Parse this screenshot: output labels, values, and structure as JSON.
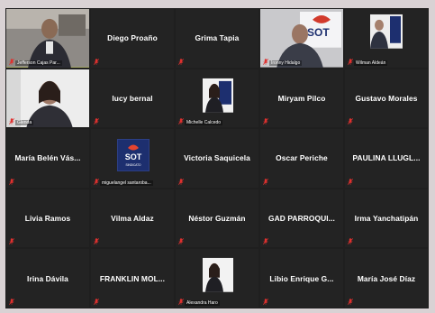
{
  "tiles": [
    {
      "id": "t1",
      "label": "Jefferson Cajas Par...",
      "kind": "video-man-office",
      "speaking": true
    },
    {
      "id": "t2",
      "name": "Diego Proaño"
    },
    {
      "id": "t3",
      "name": "Grima Tapia"
    },
    {
      "id": "t4",
      "label": "Ironny Hidalgo",
      "kind": "video-man-sot"
    },
    {
      "id": "t5",
      "label": "Wilman Aldeán",
      "kind": "video-man-small"
    },
    {
      "id": "t6",
      "label": "Glenda",
      "kind": "video-woman"
    },
    {
      "id": "t7",
      "name": "lucy bernal"
    },
    {
      "id": "t8",
      "label": "Michelle Calcedo",
      "kind": "video-woman-small"
    },
    {
      "id": "t9",
      "name": "Miryam Pilco"
    },
    {
      "id": "t10",
      "name": "Gustavo Morales"
    },
    {
      "id": "t11",
      "name": "María Belén Vás..."
    },
    {
      "id": "t12",
      "label": "miguelangel santaroba...",
      "kind": "logo-sot",
      "logo_text": "SOT",
      "logo_sub": "SINDICATO"
    },
    {
      "id": "t13",
      "name": "Victoria Saquicela"
    },
    {
      "id": "t14",
      "name": "Oscar Periche"
    },
    {
      "id": "t15",
      "name": "PAULINA LLUGL..."
    },
    {
      "id": "t16",
      "name": "Livia Ramos"
    },
    {
      "id": "t17",
      "name": "Vilma Aldaz"
    },
    {
      "id": "t18",
      "name": "Néstor Guzmán"
    },
    {
      "id": "t19",
      "name": "GAD PARROQUI..."
    },
    {
      "id": "t20",
      "name": "Irma Yanchatipán"
    },
    {
      "id": "t21",
      "name": "Irina Dávila"
    },
    {
      "id": "t22",
      "name": "FRANKLIN MOL..."
    },
    {
      "id": "t23",
      "label": "Alexandra Haro",
      "kind": "video-woman-small2"
    },
    {
      "id": "t24",
      "name": "Libio Enrique G..."
    },
    {
      "id": "t25",
      "name": "María José Díaz"
    }
  ],
  "colors": {
    "tile_bg": "#232323",
    "frame_bg": "#1f1f1f",
    "muted_mic": "#e0312f",
    "active_speaker_border": "#c5d63c",
    "sot_blue": "#1d2f6f"
  }
}
